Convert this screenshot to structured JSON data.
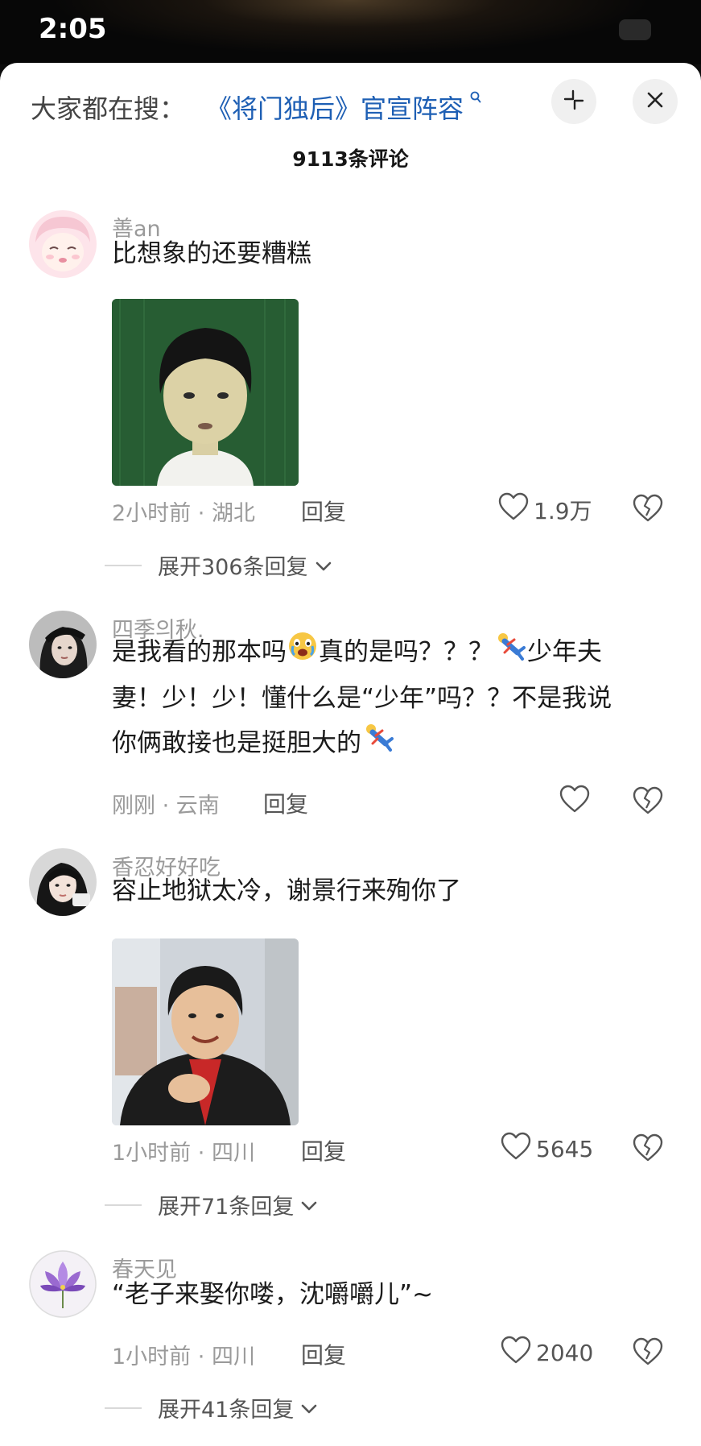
{
  "status_bar": {
    "time": "2:05"
  },
  "search": {
    "prefix": "大家都在搜：",
    "term": "《将门独后》官宣阵容"
  },
  "comments_title": "9113条评论",
  "comments": [
    {
      "username": "善an",
      "text": "比想象的还要糟糕",
      "time": "2小时前",
      "location": "湖北",
      "reply_label": "回复",
      "likes": "1.9万",
      "expand_label": "展开306条回复"
    },
    {
      "username": "四季의秋.",
      "text_line1_a": "是我看的那本吗",
      "text_line1_b": "真的是吗？？？",
      "text_line1_c": "少年夫",
      "text_line2": "妻！少！少！懂什么是“少年”吗？？不是我说",
      "text_line3": "你俩敢接也是挺胆大的",
      "time": "刚刚",
      "location": "云南",
      "reply_label": "回复",
      "likes": ""
    },
    {
      "username": "香忍好好吃",
      "text": "容止地狱太冷，谢景行来殉你了",
      "time": "1小时前",
      "location": "四川",
      "reply_label": "回复",
      "likes": "5645",
      "expand_label": "展开71条回复"
    },
    {
      "username": "春天见",
      "text": "“老子来娶你喽，沈嚼嚼儿”~",
      "time": "1小时前",
      "location": "四川",
      "reply_label": "回复",
      "likes": "2040",
      "expand_label": "展开41条回复"
    }
  ],
  "meta_separator": "·",
  "icons": [
    "shrink-icon",
    "close-icon",
    "heart-icon",
    "broken-heart-icon",
    "chevron-down-icon",
    "search-icon",
    "crying-face-emoji",
    "falling-person-emoji"
  ],
  "colors": {
    "accent_link": "#1e5fb4",
    "muted": "#9a9a9a",
    "text": "#1b1b1b"
  }
}
